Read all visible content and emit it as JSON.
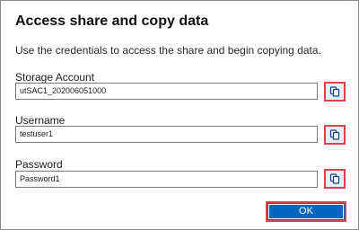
{
  "dialog": {
    "title": "Access share and copy data",
    "description": "Use the credentials to access the share and begin copying data."
  },
  "fields": [
    {
      "label": "Storage Account",
      "value": "utSAC1_202006051000",
      "copy_icon": "copy-icon"
    },
    {
      "label": "Username",
      "value": "testuser1",
      "copy_icon": "copy-icon"
    },
    {
      "label": "Password",
      "value": "Password1",
      "copy_icon": "copy-icon"
    }
  ],
  "ok_button": {
    "label": "OK"
  },
  "colors": {
    "accent": "#0067c0",
    "highlight_border": "#d9434e",
    "copy_button_bg": "#e8edf7"
  }
}
